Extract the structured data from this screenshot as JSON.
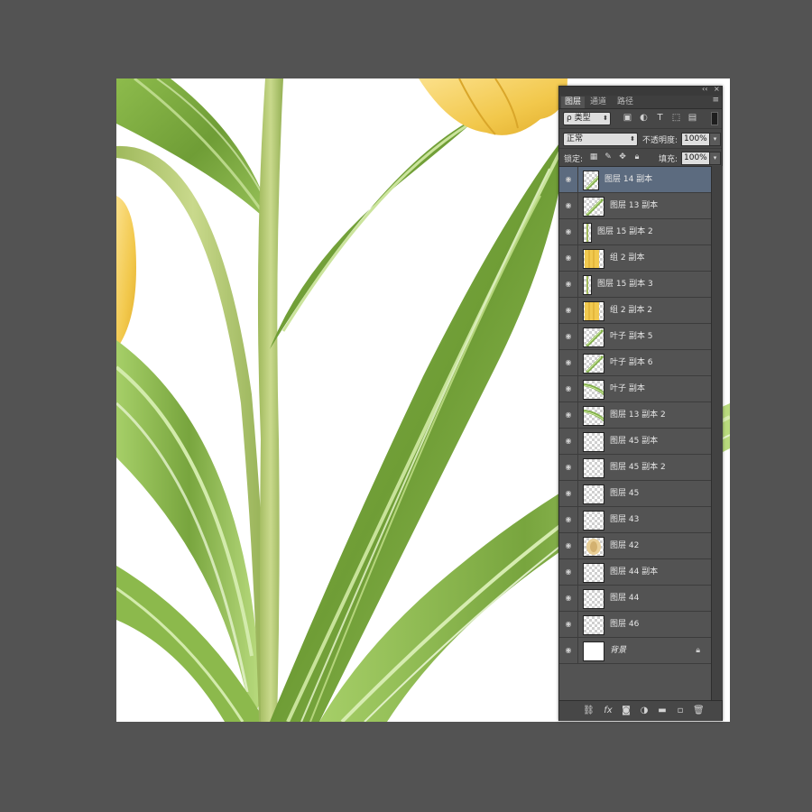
{
  "panel": {
    "collapse_glyph": "‹‹",
    "close_glyph": "×",
    "menu_glyph": "≡",
    "tabs": [
      "图层",
      "通道",
      "路径"
    ],
    "active_tab": 0
  },
  "filter": {
    "label": "ρ 类型"
  },
  "blend": {
    "mode": "正常",
    "opacity_label": "不透明度:",
    "opacity_value": "100%"
  },
  "lock": {
    "label": "锁定:",
    "fill_label": "填充:",
    "fill_value": "100%"
  },
  "layers": [
    {
      "name": "图层 14 副本",
      "selected": true,
      "thumb": "leaf-diag",
      "thumb_width": "narrow"
    },
    {
      "name": "图层 13 副本",
      "thumb": "leaf-diag"
    },
    {
      "name": "图层 15 副本 2",
      "thumb": "stem",
      "thumb_width": "thin"
    },
    {
      "name": "组 2 副本",
      "thumb": "petal-yellow"
    },
    {
      "name": "图层 15 副本 3",
      "thumb": "stem",
      "thumb_width": "thin"
    },
    {
      "name": "组 2 副本 2",
      "thumb": "petal-yellow"
    },
    {
      "name": "叶子 副本 5",
      "thumb": "leaf-diag"
    },
    {
      "name": "叶子 副本 6",
      "thumb": "leaf-diag"
    },
    {
      "name": "叶子 副本",
      "thumb": "leaf-flat"
    },
    {
      "name": "图层 13 副本 2",
      "thumb": "leaf-flat"
    },
    {
      "name": "图层 45 副本",
      "thumb": "empty"
    },
    {
      "name": "图层 45 副本 2",
      "thumb": "empty"
    },
    {
      "name": "图层 45",
      "thumb": "empty"
    },
    {
      "name": "图层 43",
      "thumb": "empty"
    },
    {
      "name": "图层 42",
      "thumb": "petal-cream"
    },
    {
      "name": "图层 44 副本",
      "thumb": "empty"
    },
    {
      "name": "图层 44",
      "thumb": "empty"
    },
    {
      "name": "图层 46",
      "thumb": "empty"
    },
    {
      "name": "背景",
      "thumb": "white",
      "background": true
    }
  ],
  "colors": {
    "workspace": "#535353",
    "selection": "#5c6b7f",
    "leaf_dark": "#6d9a35",
    "leaf_light": "#a9cd6a",
    "stem": "#a9c36a",
    "petal": "#f1c94f"
  }
}
